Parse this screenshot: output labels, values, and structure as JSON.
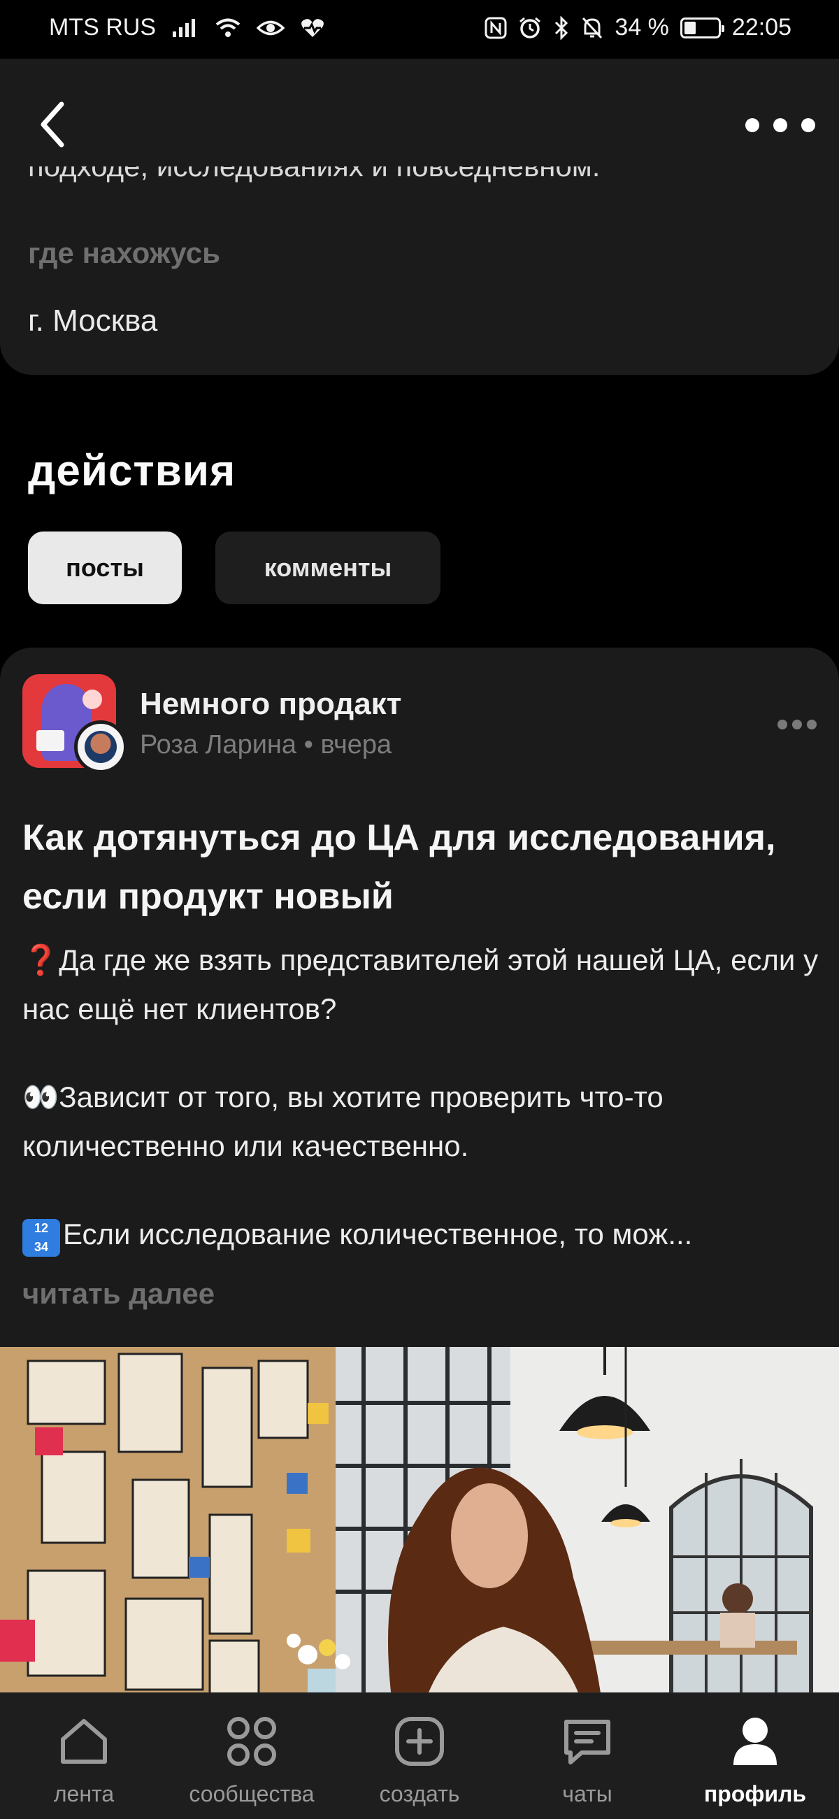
{
  "status_bar": {
    "carrier": "MTS RUS",
    "battery_text": "34 %",
    "time": "22:05",
    "battery_level": 0.34
  },
  "profile": {
    "bio_tail": "подходе, исследованиях и повседневном.",
    "location_label": "где нахожусь",
    "location_value": "г. Москва"
  },
  "actions": {
    "title": "действия",
    "tabs": [
      {
        "label": "посты",
        "active": true
      },
      {
        "label": "комменты",
        "active": false
      }
    ]
  },
  "post": {
    "community": "Немного продакт",
    "meta": "Роза Ларина • вчера",
    "title": "Как дотянуться до ЦА для исследования, если продукт новый",
    "paragraphs": [
      {
        "emoji": "❓",
        "text": "Да где же взять представителей этой нашей ЦА, если у нас ещё нет клиентов?"
      },
      {
        "emoji": "👀",
        "text": "Зависит от того, вы хотите проверить что-то количественно или качественно."
      },
      {
        "emoji": "🔢",
        "text": "Если исследование количественное, то мож..."
      }
    ],
    "read_more": "читать далее"
  },
  "nav": {
    "items": [
      {
        "label": "лента",
        "icon": "home-icon",
        "active": false
      },
      {
        "label": "сообщества",
        "icon": "grid-icon",
        "active": false
      },
      {
        "label": "создать",
        "icon": "plus-square-icon",
        "active": false
      },
      {
        "label": "чаты",
        "icon": "chat-icon",
        "active": false
      },
      {
        "label": "профиль",
        "icon": "person-icon",
        "active": true
      }
    ]
  },
  "colors": {
    "background": "#000000",
    "card": "#1b1b1b",
    "muted_text": "#6f6f6f",
    "chip_active": "#e9e9e9"
  }
}
